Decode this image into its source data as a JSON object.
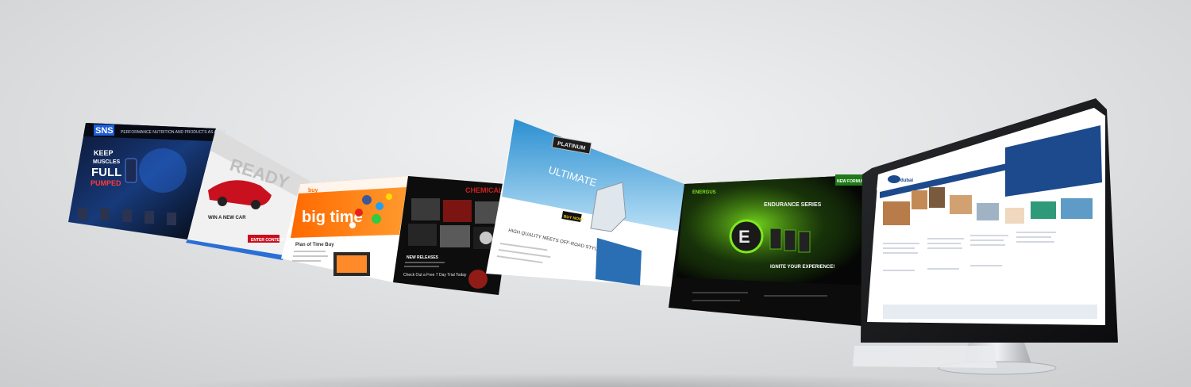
{
  "panels": [
    {
      "id": "sns",
      "logo": "SNS",
      "headline": "PERFORMANCE NUTRITION AND PRODUCTS AS A TIPE",
      "hero_lines": [
        "KEEP",
        "MUSCLES",
        "FULL",
        "PUMPED"
      ],
      "colors": {
        "bg": "#0b0f1c",
        "accent": "#2f7bff"
      }
    },
    {
      "id": "car",
      "headline": "READY",
      "promo": "WIN A NEW CAR",
      "cta": "ENTER CONTEST",
      "colors": {
        "bg": "#f4f4f4",
        "accent": "#c8101e"
      }
    },
    {
      "id": "bigtime",
      "logo": "buy",
      "headline": "big time",
      "subhead": "Plan of Time Buy",
      "colors": {
        "bg": "#ff7a12",
        "accent": "#ffffff"
      }
    },
    {
      "id": "dark",
      "logo": "CHEMICAL",
      "heading": "NEW RELEASES",
      "footer": "Check Out a Free 7 Day Trial Today",
      "colors": {
        "bg": "#0e0d0d",
        "accent": "#c9221c"
      }
    },
    {
      "id": "platinum",
      "logo": "PLATINUM",
      "headline": "ULTIMATE",
      "tagline": "HIGH QUALITY MEETS OFF-ROAD STYLE",
      "cta": "BUY NOW",
      "colors": {
        "bg": "#4ea7dc",
        "accent": "#2a6fb3"
      }
    },
    {
      "id": "energy",
      "logo": "ENERGUS",
      "headline": "ENDURANCE SERIES",
      "badge": "NEW FORMULA",
      "tagline": "IGNITE YOUR EXPERIENCE!",
      "colors": {
        "bg": "#0b0c0b",
        "accent": "#7ee81f"
      }
    },
    {
      "id": "monitor",
      "logo": "dubai",
      "colors": {
        "bg": "#ffffff",
        "accent": "#1c4a8c"
      }
    }
  ]
}
